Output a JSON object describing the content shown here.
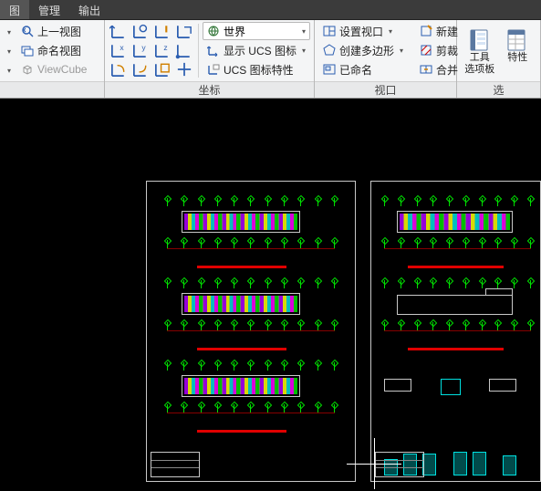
{
  "tabs": {
    "items": [
      "图",
      "管理",
      "输出"
    ],
    "activeIndex": 0
  },
  "ribbon": {
    "view_panel": {
      "prev_view": "上一视图",
      "named_view": "命名视图",
      "viewcube": "ViewCube"
    },
    "coord_panel": {
      "title": "坐标",
      "world_label": "世界",
      "show_ucs_icon": "显示 UCS 图标",
      "ucs_icon_props": "UCS 图标特性"
    },
    "viewport_panel": {
      "title": "视口",
      "set_viewport": "设置视口",
      "create_polygon": "创建多边形",
      "named": "已命名",
      "new_": "新建",
      "cut": "剪裁",
      "merge": "合并"
    },
    "palette_panel": {
      "title": "选",
      "tool_palette_l1": "工具",
      "tool_palette_l2": "选项板",
      "properties": "特性"
    }
  }
}
